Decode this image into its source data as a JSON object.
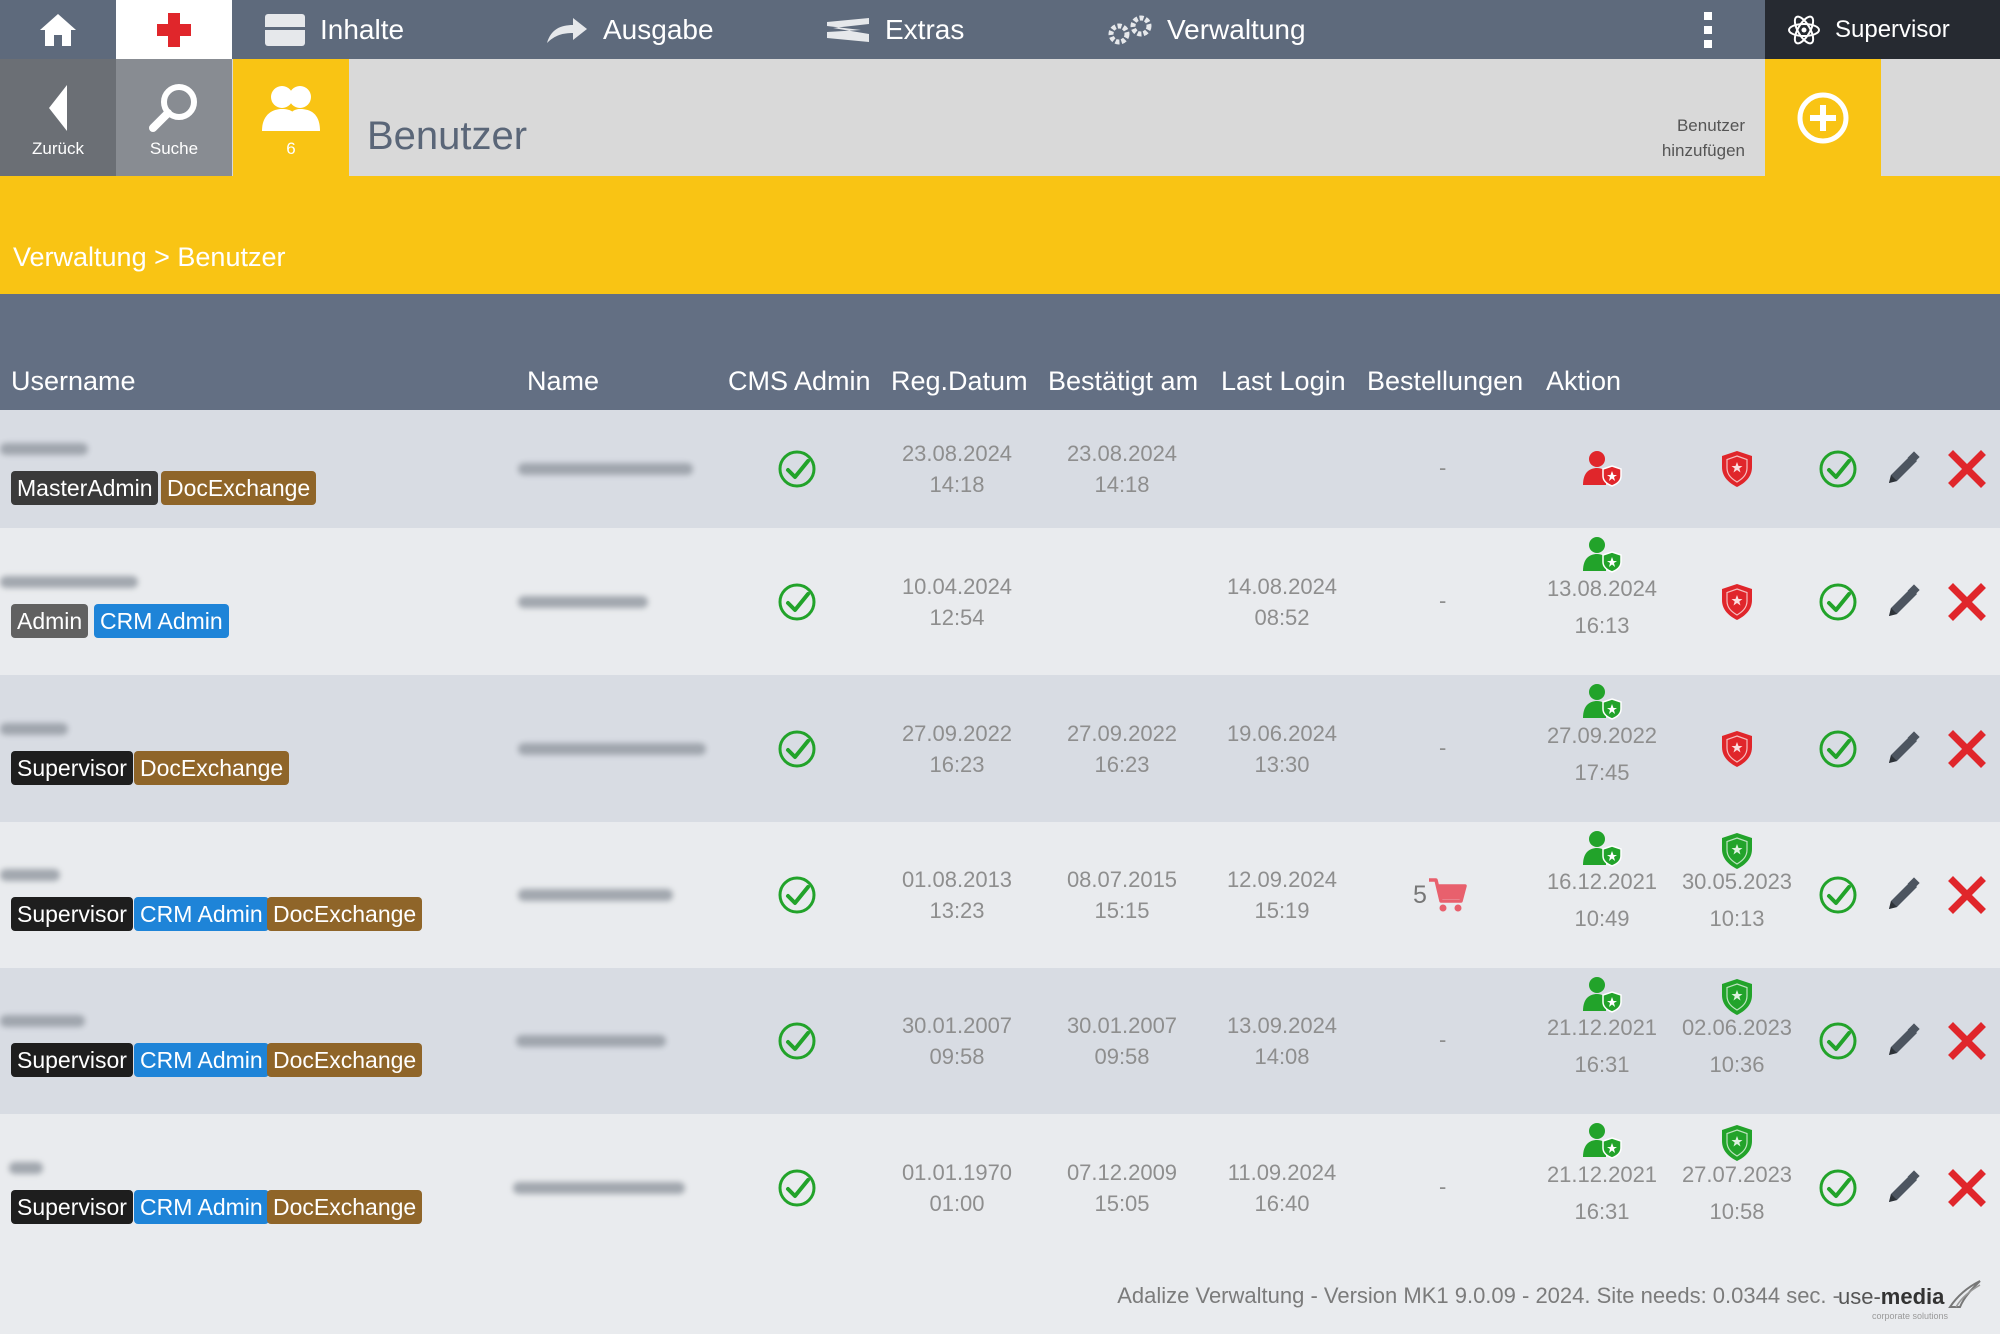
{
  "nav": {
    "items": [
      {
        "label": "Inhalte",
        "icon": "window-icon"
      },
      {
        "label": "Ausgabe",
        "icon": "arrow-forward-icon"
      },
      {
        "label": "Extras",
        "icon": "extras-icon"
      },
      {
        "label": "Verwaltung",
        "icon": "gears-icon"
      }
    ],
    "user": "Supervisor"
  },
  "toolbar": {
    "back_label": "Zurück",
    "search_label": "Suche",
    "users_count": "6",
    "page_title": "Benutzer",
    "add_label_line1": "Benutzer",
    "add_label_line2": "hinzufügen"
  },
  "breadcrumb": [
    "Verwaltung",
    ">",
    "Benutzer"
  ],
  "table": {
    "headers": [
      "Username",
      "Name",
      "CMS Admin",
      "Reg.Datum",
      "Bestätigt am",
      "Last Login",
      "Bestellungen",
      "Aktion"
    ],
    "rows": [
      {
        "badges": [
          {
            "label": "MasterAdmin",
            "kind": "master"
          },
          {
            "label": "DocExchange",
            "kind": "doc"
          }
        ],
        "reg": [
          "23.08.2024",
          "14:18"
        ],
        "confirmed": [
          "23.08.2024",
          "14:18"
        ],
        "last_login": [
          "",
          ""
        ],
        "orders": "-",
        "user_status": "red",
        "user_date": [
          "",
          ""
        ],
        "shield_status": "red",
        "shield_date": [
          "",
          ""
        ]
      },
      {
        "badges": [
          {
            "label": "Admin",
            "kind": "admin"
          },
          {
            "label": "CRM Admin",
            "kind": "crm"
          }
        ],
        "reg": [
          "10.04.2024",
          "12:54"
        ],
        "confirmed": [
          "",
          ""
        ],
        "last_login": [
          "14.08.2024",
          "08:52"
        ],
        "orders": "-",
        "user_status": "green",
        "user_date": [
          "13.08.2024",
          "16:13"
        ],
        "shield_status": "red",
        "shield_date": [
          "",
          ""
        ]
      },
      {
        "badges": [
          {
            "label": "Supervisor",
            "kind": "super"
          },
          {
            "label": "DocExchange",
            "kind": "doc"
          }
        ],
        "reg": [
          "27.09.2022",
          "16:23"
        ],
        "confirmed": [
          "27.09.2022",
          "16:23"
        ],
        "last_login": [
          "19.06.2024",
          "13:30"
        ],
        "orders": "-",
        "user_status": "green",
        "user_date": [
          "27.09.2022",
          "17:45"
        ],
        "shield_status": "red",
        "shield_date": [
          "",
          ""
        ]
      },
      {
        "badges": [
          {
            "label": "Supervisor",
            "kind": "super"
          },
          {
            "label": "CRM Admin",
            "kind": "crm"
          },
          {
            "label": "DocExchange",
            "kind": "doc"
          }
        ],
        "reg": [
          "01.08.2013",
          "13:23"
        ],
        "confirmed": [
          "08.07.2015",
          "15:15"
        ],
        "last_login": [
          "12.09.2024",
          "15:19"
        ],
        "orders": "5",
        "user_status": "green",
        "user_date": [
          "16.12.2021",
          "10:49"
        ],
        "shield_status": "green",
        "shield_date": [
          "30.05.2023",
          "10:13"
        ]
      },
      {
        "badges": [
          {
            "label": "Supervisor",
            "kind": "super"
          },
          {
            "label": "CRM Admin",
            "kind": "crm"
          },
          {
            "label": "DocExchange",
            "kind": "doc"
          }
        ],
        "reg": [
          "30.01.2007",
          "09:58"
        ],
        "confirmed": [
          "30.01.2007",
          "09:58"
        ],
        "last_login": [
          "13.09.2024",
          "14:08"
        ],
        "orders": "-",
        "user_status": "green",
        "user_date": [
          "21.12.2021",
          "16:31"
        ],
        "shield_status": "green",
        "shield_date": [
          "02.06.2023",
          "10:36"
        ]
      },
      {
        "badges": [
          {
            "label": "Supervisor",
            "kind": "super"
          },
          {
            "label": "CRM Admin",
            "kind": "crm"
          },
          {
            "label": "DocExchange",
            "kind": "doc"
          }
        ],
        "reg": [
          "01.01.1970",
          "01:00"
        ],
        "confirmed": [
          "07.12.2009",
          "15:05"
        ],
        "last_login": [
          "11.09.2024",
          "16:40"
        ],
        "orders": "-",
        "user_status": "green",
        "user_date": [
          "21.12.2021",
          "16:31"
        ],
        "shield_status": "green",
        "shield_date": [
          "27.07.2023",
          "10:58"
        ]
      }
    ]
  },
  "footer": {
    "text": "Adalize Verwaltung - Version MK1 9.0.09 - 2024. Site needs: 0.0344 sec. -",
    "brand_prefix": "use-",
    "brand_name": "media",
    "brand_sub": "corporate solutions"
  },
  "colors": {
    "nav_bg": "#5e6a7c",
    "accent_yellow": "#f9c414",
    "header_bg": "#636f83",
    "row_odd": "#d8dce3",
    "row_even": "#e9ebee",
    "ok_green": "#22a32a",
    "danger_red": "#e0262b",
    "badge_crm": "#1e84d8",
    "badge_doc": "#8f6529",
    "badge_super": "#1e1e1e"
  }
}
